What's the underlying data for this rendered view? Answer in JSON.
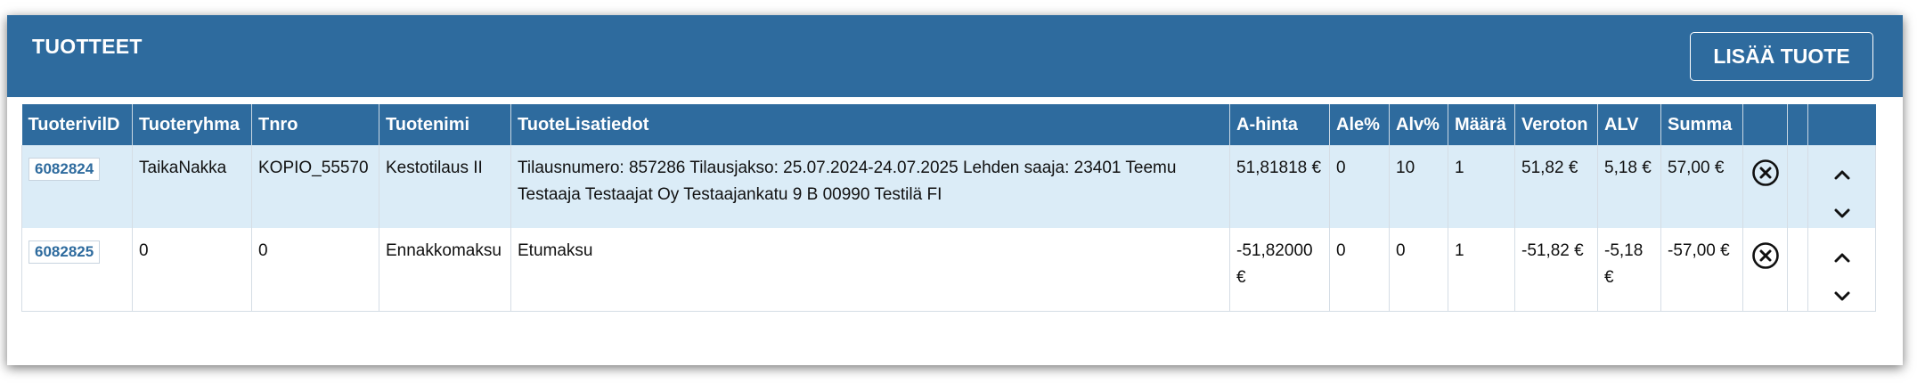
{
  "panel": {
    "title": "TUOTTEET",
    "add_button_label": "LISÄÄ TUOTE"
  },
  "table": {
    "headers": [
      "TuoterivilD",
      "Tuoteryhma",
      "Tnro",
      "Tuotenimi",
      "TuoteLisatiedot",
      "A-hinta",
      "Ale%",
      "Alv%",
      "Määrä",
      "Veroton",
      "ALV",
      "Summa",
      "",
      "",
      ""
    ],
    "rows": [
      {
        "id": "6082824",
        "group": "TaikaNakka",
        "tnro": "KOPIO_55570",
        "name": "Kestotilaus II",
        "details": "Tilausnumero: 857286 Tilausjakso: 25.07.2024-24.07.2025 Lehden saaja: 23401 Teemu Testaaja Testaajat Oy Testaajankatu 9 B 00990 Testilä FI",
        "unit_price": "51,81818 €",
        "discount": "0",
        "vat_pct": "10",
        "quantity": "1",
        "net": "51,82 €",
        "vat": "5,18 €",
        "total": "57,00 €"
      },
      {
        "id": "6082825",
        "group": "0",
        "tnro": "0",
        "name": "Ennakkomaksu",
        "details": "Etumaksu",
        "unit_price": "-51,82000 €",
        "discount": "0",
        "vat_pct": "0",
        "quantity": "1",
        "net": "-51,82 €",
        "vat": "-5,18 €",
        "total": "-57,00 €"
      }
    ]
  },
  "icons": {
    "remove": "close-circle-icon",
    "move_up": "chevron-up-icon",
    "move_down": "chevron-down-icon"
  },
  "colors": {
    "header_blue": "#2e6b9e",
    "row_highlight": "#dbecf7"
  }
}
